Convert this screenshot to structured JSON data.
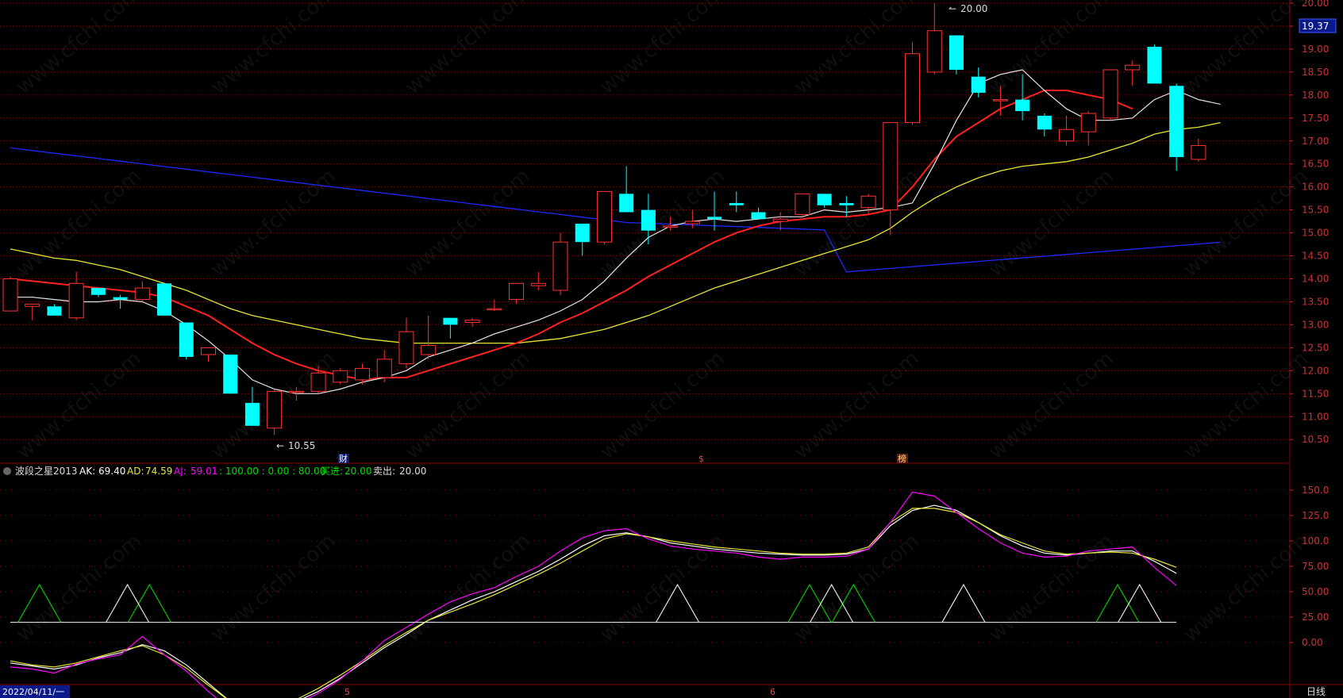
{
  "main_panel": {
    "price_axis": [
      "20.00",
      "19.50",
      "19.00",
      "18.50",
      "18.00",
      "17.50",
      "17.00",
      "16.50",
      "16.00",
      "15.50",
      "15.00",
      "14.50",
      "14.00",
      "13.50",
      "13.00",
      "12.50",
      "12.00",
      "11.50",
      "11.00",
      "10.50"
    ],
    "last_price": "19.37",
    "high_label": "20.00",
    "low_label": "10.55",
    "event_markers": [
      "财",
      "$",
      "榜"
    ],
    "colors": {
      "up": "#ff3232",
      "down": "#00ffff",
      "ma5": "#e6e6e6",
      "ma10": "#ff2020",
      "ma20": "#e6e632",
      "ma60": "#1e28ff",
      "grid": "#8b0000"
    }
  },
  "indicator_panel": {
    "name": "波段之星2013",
    "ak_label": "AK:",
    "ak_value": "69.40",
    "ad_label": "AD:",
    "ad_value": "74.59",
    "aj_label": "AJ:",
    "aj_value": "59.01",
    "levels_text": ": 100.00 : 0.00 : 80.00",
    "buy_label": "买进:",
    "buy_value": "20.00",
    "sell_label": "卖出:",
    "sell_value": "20.00",
    "axis": [
      "150.0",
      "125.0",
      "100.0",
      "75.00",
      "50.00",
      "25.00",
      "0.00"
    ],
    "colors": {
      "ak": "#ffffff",
      "ad": "#e6e632",
      "aj": "#ff00ff",
      "buy": "#00c800",
      "sell": "#e6e6e6"
    }
  },
  "footer": {
    "date": "2022/04/11/一",
    "month_marks": [
      "5",
      "6"
    ],
    "period": "日线"
  },
  "watermark": "www.cfchi.com",
  "chart_data": [
    {
      "type": "candlestick",
      "ylim": [
        10.4,
        20.0
      ],
      "ohlc": [
        [
          13.3,
          14.05,
          13.35,
          14.0
        ],
        [
          13.4,
          13.45,
          13.1,
          13.45
        ],
        [
          13.4,
          13.45,
          13.2,
          13.2
        ],
        [
          13.15,
          14.15,
          13.1,
          13.9
        ],
        [
          13.8,
          13.8,
          13.6,
          13.65
        ],
        [
          13.6,
          13.65,
          13.35,
          13.55
        ],
        [
          13.55,
          13.95,
          13.5,
          13.8
        ],
        [
          13.9,
          13.9,
          13.2,
          13.2
        ],
        [
          13.05,
          13.05,
          12.25,
          12.3
        ],
        [
          12.35,
          12.5,
          12.2,
          12.5
        ],
        [
          12.35,
          12.35,
          11.5,
          11.5
        ],
        [
          11.3,
          11.65,
          10.85,
          10.8
        ],
        [
          10.75,
          11.6,
          10.6,
          11.55
        ],
        [
          11.55,
          11.65,
          11.35,
          11.55
        ],
        [
          11.55,
          12.1,
          11.5,
          11.95
        ],
        [
          11.75,
          12.05,
          11.7,
          12.0
        ],
        [
          11.8,
          12.15,
          11.7,
          12.05
        ],
        [
          11.85,
          12.45,
          11.75,
          12.25
        ],
        [
          12.15,
          13.15,
          12.05,
          12.85
        ],
        [
          12.35,
          13.2,
          12.25,
          12.55
        ],
        [
          13.15,
          13.15,
          12.7,
          13.0
        ],
        [
          13.05,
          13.15,
          12.95,
          13.1
        ],
        [
          13.35,
          13.55,
          13.3,
          13.35
        ],
        [
          13.55,
          13.9,
          13.45,
          13.9
        ],
        [
          13.85,
          14.15,
          13.75,
          13.9
        ],
        [
          13.75,
          15.0,
          13.65,
          14.8
        ],
        [
          15.2,
          15.2,
          14.5,
          14.8
        ],
        [
          14.8,
          15.9,
          14.75,
          15.9
        ],
        [
          15.85,
          16.45,
          15.45,
          15.45
        ],
        [
          15.5,
          15.85,
          14.75,
          15.05
        ],
        [
          15.15,
          15.35,
          15.05,
          15.15
        ],
        [
          15.2,
          15.5,
          15.1,
          15.25
        ],
        [
          15.35,
          15.9,
          15.05,
          15.3
        ],
        [
          15.65,
          15.9,
          15.45,
          15.6
        ],
        [
          15.45,
          15.55,
          15.3,
          15.3
        ],
        [
          15.25,
          15.45,
          15.05,
          15.3
        ],
        [
          15.4,
          15.75,
          15.35,
          15.85
        ],
        [
          15.85,
          15.85,
          15.55,
          15.6
        ],
        [
          15.65,
          15.8,
          15.35,
          15.6
        ],
        [
          15.55,
          15.85,
          15.4,
          15.8
        ],
        [
          15.5,
          15.5,
          14.95,
          17.4
        ],
        [
          17.4,
          19.15,
          17.35,
          18.9
        ],
        [
          18.5,
          20.0,
          18.45,
          19.4
        ],
        [
          19.3,
          19.3,
          18.45,
          18.55
        ],
        [
          18.4,
          18.6,
          17.95,
          18.05
        ],
        [
          17.9,
          18.2,
          17.55,
          17.9
        ],
        [
          17.9,
          18.45,
          17.45,
          17.65
        ],
        [
          17.55,
          17.6,
          17.1,
          17.25
        ],
        [
          17.0,
          17.55,
          16.9,
          17.25
        ],
        [
          17.2,
          17.65,
          16.9,
          17.6
        ],
        [
          17.5,
          17.65,
          17.45,
          18.55
        ],
        [
          18.55,
          18.75,
          18.2,
          18.65
        ],
        [
          19.05,
          19.1,
          18.25,
          18.25
        ],
        [
          18.2,
          18.25,
          16.35,
          16.65
        ],
        [
          16.6,
          17.05,
          16.55,
          16.9
        ]
      ],
      "ma5": [
        13.6,
        13.6,
        13.55,
        13.5,
        13.5,
        13.55,
        13.5,
        13.3,
        13.0,
        12.65,
        12.25,
        11.8,
        11.6,
        11.5,
        11.5,
        11.6,
        11.75,
        11.85,
        12.0,
        12.3,
        12.45,
        12.6,
        12.8,
        12.95,
        13.1,
        13.3,
        13.55,
        13.95,
        14.45,
        14.9,
        15.15,
        15.25,
        15.3,
        15.25,
        15.3,
        15.35,
        15.35,
        15.5,
        15.45,
        15.5,
        15.55,
        15.65,
        16.5,
        17.45,
        18.25,
        18.45,
        18.55,
        18.1,
        17.7,
        17.45,
        17.45,
        17.5,
        17.9,
        18.1,
        17.9,
        17.8
      ],
      "ma10": [
        14.0,
        13.95,
        13.9,
        13.85,
        13.8,
        13.75,
        13.7,
        13.6,
        13.4,
        13.2,
        12.9,
        12.6,
        12.35,
        12.15,
        12.0,
        11.9,
        11.8,
        11.85,
        11.85,
        12.0,
        12.15,
        12.3,
        12.45,
        12.6,
        12.8,
        13.05,
        13.25,
        13.5,
        13.75,
        14.05,
        14.3,
        14.55,
        14.8,
        15.0,
        15.15,
        15.25,
        15.3,
        15.35,
        15.35,
        15.4,
        15.5,
        16.0,
        16.6,
        17.1,
        17.4,
        17.7,
        17.9,
        18.1,
        18.1,
        18.0,
        17.9,
        17.7
      ]
    },
    {
      "type": "line",
      "ylim": [
        -35,
        160
      ],
      "series": [
        {
          "name": "AK",
          "values": [
            -20,
            -23,
            -26,
            -22,
            -15,
            -10,
            -2,
            -8,
            -22,
            -40,
            -58,
            -70,
            -68,
            -58,
            -48,
            -35,
            -20,
            -5,
            8,
            22,
            32,
            42,
            50,
            60,
            70,
            82,
            95,
            105,
            108,
            104,
            98,
            95,
            92,
            90,
            88,
            87,
            86,
            86,
            87,
            92,
            115,
            130,
            135,
            130,
            118,
            105,
            95,
            88,
            86,
            88,
            90,
            90,
            80,
            68
          ]
        },
        {
          "name": "AD",
          "values": [
            -18,
            -22,
            -24,
            -20,
            -14,
            -8,
            -3,
            -12,
            -25,
            -42,
            -58,
            -68,
            -66,
            -56,
            -45,
            -32,
            -18,
            -3,
            10,
            22,
            30,
            38,
            47,
            57,
            67,
            78,
            90,
            102,
            107,
            104,
            100,
            97,
            94,
            92,
            90,
            88,
            87,
            87,
            88,
            94,
            118,
            132,
            132,
            128,
            118,
            106,
            98,
            90,
            87,
            88,
            89,
            88,
            82,
            74
          ]
        },
        {
          "name": "AJ",
          "values": [
            -24,
            -26,
            -30,
            -21,
            -16,
            -12,
            6,
            -12,
            -28,
            -48,
            -66,
            -78,
            -74,
            -60,
            -50,
            -36,
            -18,
            2,
            15,
            28,
            40,
            48,
            54,
            65,
            75,
            90,
            103,
            110,
            112,
            102,
            95,
            92,
            90,
            88,
            84,
            82,
            84,
            84,
            85,
            92,
            118,
            148,
            144,
            128,
            112,
            98,
            88,
            84,
            85,
            90,
            92,
            94,
            74,
            56
          ]
        },
        {
          "name": "buy",
          "values": [
            20,
            57,
            20,
            20,
            20,
            20,
            57,
            20,
            20,
            20,
            20,
            20,
            20,
            20,
            20,
            20,
            20,
            20,
            20,
            20,
            20,
            20,
            20,
            20,
            20,
            20,
            20,
            20,
            20,
            20,
            20,
            20,
            20,
            20,
            20,
            20,
            57,
            20,
            57,
            20,
            20,
            20,
            20,
            20,
            20,
            20,
            20,
            20,
            20,
            20,
            57,
            20,
            20,
            20,
            20,
            20
          ]
        },
        {
          "name": "sell",
          "values": [
            20,
            20,
            20,
            20,
            20,
            57,
            20,
            20,
            20,
            20,
            20,
            20,
            20,
            20,
            20,
            20,
            20,
            20,
            20,
            20,
            20,
            20,
            20,
            20,
            20,
            20,
            20,
            20,
            20,
            20,
            57,
            20,
            20,
            20,
            20,
            20,
            20,
            57,
            20,
            20,
            20,
            20,
            20,
            57,
            20,
            20,
            20,
            20,
            20,
            20,
            20,
            57,
            20,
            20,
            20,
            20
          ]
        }
      ]
    }
  ]
}
